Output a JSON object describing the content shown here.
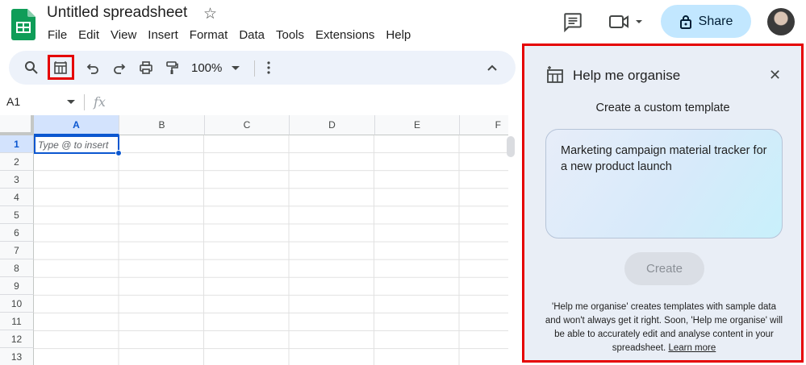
{
  "app": {
    "doc_title": "Untitled spreadsheet",
    "menu": [
      "File",
      "Edit",
      "View",
      "Insert",
      "Format",
      "Data",
      "Tools",
      "Extensions",
      "Help"
    ],
    "share_label": "Share"
  },
  "toolbar": {
    "zoom": "100%"
  },
  "formula_bar": {
    "cell_ref": "A1",
    "fx": "fx"
  },
  "sheet": {
    "columns": [
      "A",
      "B",
      "C",
      "D",
      "E",
      "F"
    ],
    "rows": [
      "1",
      "2",
      "3",
      "4",
      "5",
      "6",
      "7",
      "8",
      "9",
      "10",
      "11",
      "12",
      "13"
    ],
    "active_cell_placeholder": "Type @ to insert"
  },
  "panel": {
    "title": "Help me organise",
    "subtitle": "Create a custom template",
    "prompt_value": "Marketing campaign material tracker for a new product launch",
    "create_label": "Create",
    "disclaimer": "'Help me organise' creates templates with sample data and won't always get it right. Soon, 'Help me organise' will be able to accurately edit and analyse content in your spreadsheet.",
    "learn_more": "Learn more"
  },
  "colors": {
    "accent": "#0b57d0",
    "share_bg": "#c2e7ff",
    "highlight": "#e50000",
    "panel_bg": "#e9eef6"
  }
}
